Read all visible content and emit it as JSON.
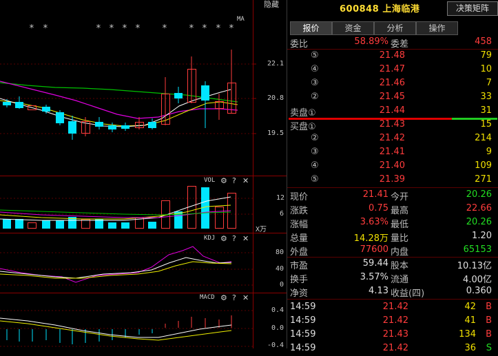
{
  "toolbar": {
    "hide_label": "隐藏"
  },
  "chart": {
    "ma_label": "MA",
    "price_ticks": [
      "22.1",
      "20.8",
      "19.5"
    ],
    "vol": {
      "title": "VOL",
      "ticks": [
        "12",
        "6"
      ],
      "unit": "X万"
    },
    "kdj": {
      "title": "KDJ",
      "ticks": [
        "80",
        "40",
        "0"
      ]
    },
    "macd": {
      "title": "MACD",
      "ticks": [
        "0.4",
        "0.0",
        "-0.4"
      ]
    },
    "stars": [
      "*",
      "*",
      "*",
      "*",
      "*",
      "*",
      "*",
      "*",
      "*",
      "*",
      "*",
      "*"
    ]
  },
  "stock": {
    "code": "600848",
    "name": "上海临港",
    "decision_label": "决策矩阵"
  },
  "tabs": [
    "报价",
    "资金",
    "分析",
    "操作"
  ],
  "weibi": {
    "label": "委比",
    "value": "58.89%",
    "diff_label": "委差",
    "diff": "458"
  },
  "sell_orders": [
    {
      "label": "⑤",
      "price": "21.48",
      "vol": "79"
    },
    {
      "label": "④",
      "price": "21.47",
      "vol": "10"
    },
    {
      "label": "③",
      "price": "21.46",
      "vol": "7"
    },
    {
      "label": "②",
      "price": "21.45",
      "vol": "33"
    },
    {
      "label": "卖盘①",
      "price": "21.44",
      "vol": "31"
    }
  ],
  "buy_orders": [
    {
      "label": "买盘①",
      "price": "21.43",
      "vol": "15"
    },
    {
      "label": "②",
      "price": "21.42",
      "vol": "214"
    },
    {
      "label": "③",
      "price": "21.41",
      "vol": "9"
    },
    {
      "label": "④",
      "price": "21.40",
      "vol": "109"
    },
    {
      "label": "⑤",
      "price": "21.39",
      "vol": "271"
    }
  ],
  "quote": [
    {
      "l1": "现价",
      "v1": "21.41",
      "c1": "red",
      "l2": "今开",
      "v2": "20.26",
      "c2": "green"
    },
    {
      "l1": "涨跌",
      "v1": "0.75",
      "c1": "red",
      "l2": "最高",
      "v2": "22.66",
      "c2": "red"
    },
    {
      "l1": "涨幅",
      "v1": "3.63%",
      "c1": "red",
      "l2": "最低",
      "v2": "20.26",
      "c2": "green"
    },
    {
      "l1": "总量",
      "v1": "14.28万",
      "c1": "yellow",
      "l2": "量比",
      "v2": "1.20",
      "c2": "white"
    },
    {
      "l1": "外盘",
      "v1": "77600",
      "c1": "red",
      "l2": "内盘",
      "v2": "65153",
      "c2": "green"
    }
  ],
  "fundamentals": [
    {
      "l1": "市盈",
      "v1": "59.44",
      "l2": "股本",
      "v2": "10.13亿"
    },
    {
      "l1": "换手",
      "v1": "3.57%",
      "l2": "流通",
      "v2": "4.00亿"
    },
    {
      "l1": "净资",
      "v1": "4.13",
      "l2": "收益(四)",
      "v2": "0.360"
    }
  ],
  "ticks": [
    {
      "time": "14:59",
      "price": "21.42",
      "vol": "42",
      "side": "B"
    },
    {
      "time": "14:59",
      "price": "21.42",
      "vol": "41",
      "side": "B"
    },
    {
      "time": "14:59",
      "price": "21.43",
      "vol": "134",
      "side": "B"
    },
    {
      "time": "14:59",
      "price": "21.42",
      "vol": "36",
      "side": "S"
    }
  ],
  "colors": {
    "up": "#ff3c3c",
    "down": "#00e5ff",
    "ma_white": "#ffffff",
    "ma_yellow": "#f0f000",
    "ma_magenta": "#e000e0",
    "ma_green": "#00c000"
  }
}
